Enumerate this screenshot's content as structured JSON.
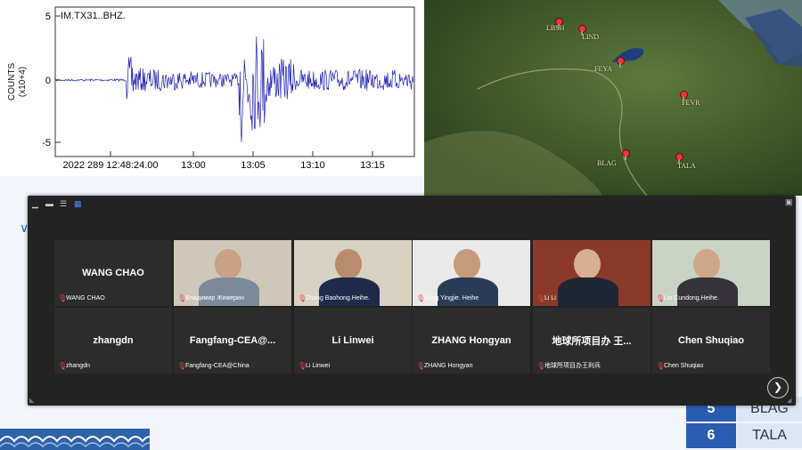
{
  "seismogram": {
    "station_label": "IM.TX31..BHZ.",
    "y_axis_label": "COUNTS",
    "y_axis_unit": "(x10+4)",
    "y_ticks": [
      "5",
      "0",
      "-5"
    ],
    "x_ticks": [
      "2022 289 12:48:24.00",
      "13:00",
      "13:05",
      "13:10",
      "13:15"
    ],
    "trace_color": "#1f1fb8"
  },
  "map": {
    "stations": [
      {
        "name": "LBSH"
      },
      {
        "name": "LIND"
      },
      {
        "name": "FEYA"
      },
      {
        "name": "FEVR"
      },
      {
        "name": "BLAG"
      },
      {
        "name": "TALA"
      }
    ]
  },
  "slide_table": {
    "rows": [
      {
        "num": "5",
        "name": "BLAG"
      },
      {
        "num": "6",
        "name": "TALA"
      }
    ]
  },
  "meeting": {
    "active_color": "#c8cf3f",
    "tiles": [
      {
        "name": "WANG CHAO",
        "label": "WANG CHAO",
        "video": false
      },
      {
        "name": "",
        "label": "Владимир Жижерин",
        "video": true
      },
      {
        "name": "",
        "label": "Zhang Baohong.Heihe.",
        "video": true
      },
      {
        "name": "",
        "label": "Song Yingjie. Heihe",
        "video": true,
        "active": true
      },
      {
        "name": "",
        "label": "Li Li",
        "video": true
      },
      {
        "name": "",
        "label": "Lin Cundong.Heihe.",
        "video": true
      },
      {
        "name": "zhangdn",
        "label": "zhangdn",
        "video": false
      },
      {
        "name": "Fangfang-CEA@...",
        "label": "Fangfang-CEA@China",
        "video": false
      },
      {
        "name": "Li Linwei",
        "label": "Li Linwei",
        "video": false
      },
      {
        "name": "ZHANG Hongyan",
        "label": "ZHANG Hongyan",
        "video": false
      },
      {
        "name": "地球所项目办 王...",
        "label": "地球所项目办王利兵",
        "video": false
      },
      {
        "name": "Chen Shuqiao",
        "label": "Chen Shuqiao",
        "video": false
      }
    ]
  }
}
